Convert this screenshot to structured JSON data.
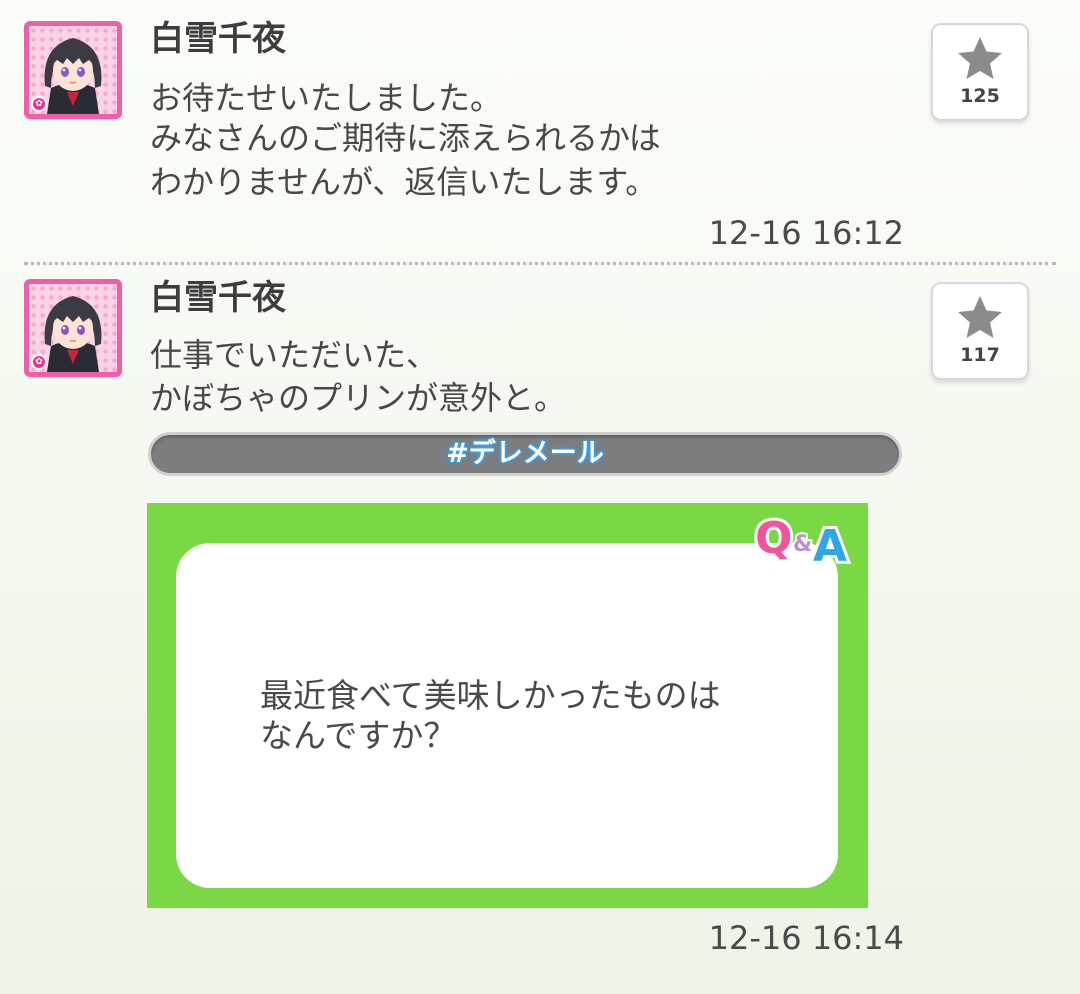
{
  "posts": [
    {
      "author": "白雪千夜",
      "lines": [
        "お待たせいたしました。",
        "みなさんのご期待に添えられるかは",
        "わかりませんが、返信いたします。"
      ],
      "favorite_count": "125",
      "timestamp": "12-16 16:12"
    },
    {
      "author": "白雪千夜",
      "lines": [
        "仕事でいただいた、",
        "かぼちゃのプリンが意外と。"
      ],
      "favorite_count": "117",
      "hashtag": "#デレメール",
      "qa": {
        "logo_q": "Q",
        "logo_amp": "&",
        "logo_a": "A",
        "question_lines": [
          "最近食べて美味しかったものは",
          "なんですか？"
        ]
      },
      "timestamp": "12-16 16:14"
    }
  ],
  "colors": {
    "avatar_border": "#ef5fa8",
    "qa_frame": "#7bd845",
    "hashtag_glow": "#2ea7ff"
  },
  "icons": [
    "star-icon",
    "avatar-image",
    "qa-logo-icon"
  ]
}
